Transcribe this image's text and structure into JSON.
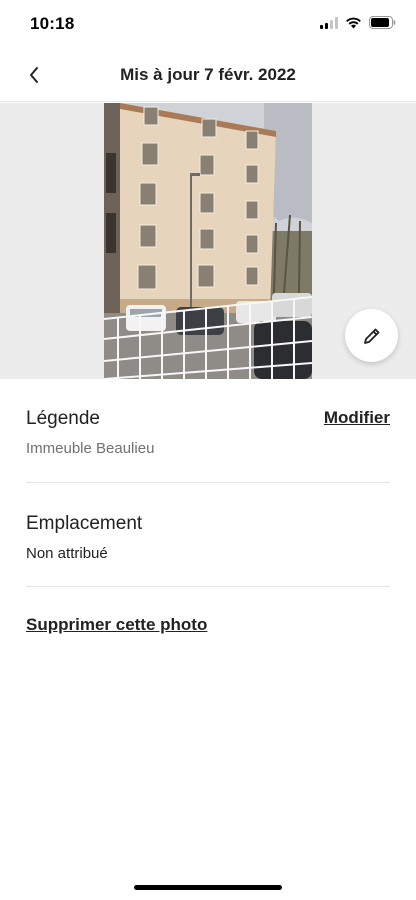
{
  "status_bar": {
    "time": "10:18",
    "icons": [
      "cellular-signal-icon",
      "wifi-icon",
      "battery-icon"
    ]
  },
  "nav": {
    "back_icon": "chevron-left-icon",
    "title": "Mis à jour 7 févr. 2022"
  },
  "photo": {
    "description_icon": "photo-building",
    "edit_icon": "pencil-icon"
  },
  "legend": {
    "title": "Légende",
    "value": "Immeuble Beaulieu",
    "modify_label": "Modifier"
  },
  "location": {
    "title": "Emplacement",
    "value": "Non attribué"
  },
  "delete_label": "Supprimer cette photo",
  "colors": {
    "text_primary": "#222222",
    "text_secondary": "#717171",
    "divider": "#e6e6e6",
    "photo_background": "#ececec"
  }
}
